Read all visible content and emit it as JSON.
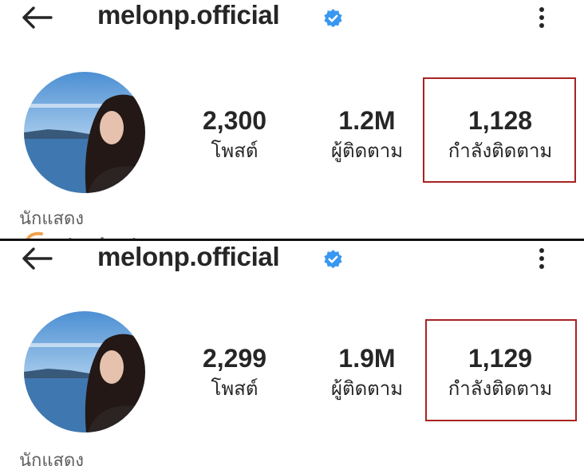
{
  "panels": [
    {
      "username": "melonp.official",
      "stats": [
        {
          "value": "2,300",
          "label": "โพสต์"
        },
        {
          "value": "1.2M",
          "label": "ผู้ติดตาม"
        },
        {
          "value": "1,128",
          "label": "กำลังติดตาม"
        }
      ],
      "bio": "นักแสดง"
    },
    {
      "username": "melonp.official",
      "stats": [
        {
          "value": "2,299",
          "label": "โพสต์"
        },
        {
          "value": "1.9M",
          "label": "ผู้ติดตาม"
        },
        {
          "value": "1,129",
          "label": "กำลังติดตาม"
        }
      ],
      "bio": "นักแสดง"
    }
  ],
  "icons": {
    "back": "arrow-left-icon",
    "verified": "verified-badge-icon",
    "more": "more-vertical-icon"
  },
  "colors": {
    "verified": "#3897f0",
    "highlight_box": "#a82323",
    "text": "#262626",
    "muted_text": "#5f5f5f"
  }
}
